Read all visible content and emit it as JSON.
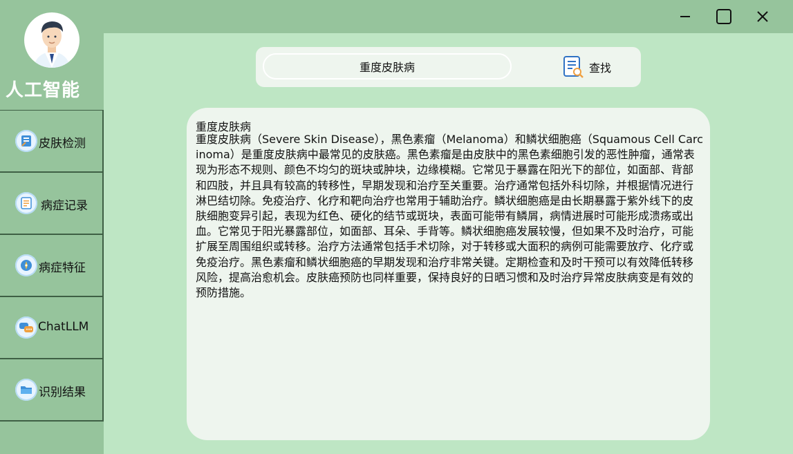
{
  "app": {
    "title": "人工智能"
  },
  "window_controls": {
    "minimize_icon": "minimize-icon",
    "maximize_icon": "maximize-icon",
    "close_icon": "close-icon"
  },
  "sidebar": {
    "items": [
      {
        "label": "皮肤检测",
        "icon": "skin-detect-icon"
      },
      {
        "label": "病症记录",
        "icon": "records-icon"
      },
      {
        "label": "病症特征",
        "icon": "features-icon"
      },
      {
        "label": "ChatLLM",
        "icon": "chat-icon"
      },
      {
        "label": "识别结果",
        "icon": "folder-icon"
      }
    ]
  },
  "search": {
    "value": "重度皮肤病",
    "button_label": "查找",
    "button_icon": "document-search-icon"
  },
  "content": {
    "title": "重度皮肤病",
    "body": "重度皮肤病（Severe Skin Disease），黑色素瘤（Melanoma）和鳞状细胞癌（Squamous Cell Carcinoma）是重度皮肤病中最常见的皮肤癌。黑色素瘤是由皮肤中的黑色素细胞引发的恶性肿瘤，通常表现为形态不规则、颜色不均匀的斑块或肿块，边缘模糊。它常见于暴露在阳光下的部位，如面部、背部和四肢，并且具有较高的转移性，早期发现和治疗至关重要。治疗通常包括外科切除，并根据情况进行淋巴结切除。免疫治疗、化疗和靶向治疗也常用于辅助治疗。鳞状细胞癌是由长期暴露于紫外线下的皮肤细胞变异引起，表现为红色、硬化的结节或斑块，表面可能带有鳞屑，病情进展时可能形成溃疡或出血。它常见于阳光暴露部位，如面部、耳朵、手背等。鳞状细胞癌发展较慢，但如果不及时治疗，可能扩展至周围组织或转移。治疗方法通常包括手术切除，对于转移或大面积的病例可能需要放疗、化疗或免疫治疗。黑色素瘤和鳞状细胞癌的早期发现和治疗非常关键。定期检查和及时干预可以有效降低转移风险，提高治愈机会。皮肤癌预防也同样重要，保持良好的日晒习惯和及时治疗异常皮肤病变是有效的预防措施。"
  },
  "colors": {
    "sidebar_bg": "#96c49c",
    "main_bg": "#bee6c4",
    "panel_bg": "#eef5ee",
    "nav_border": "#3e5f44"
  }
}
